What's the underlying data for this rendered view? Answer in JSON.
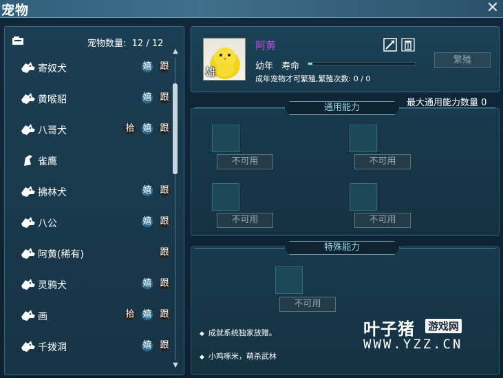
{
  "window": {
    "title": "宠物"
  },
  "left_panel": {
    "count_label": "宠物数量:",
    "count_current": "12",
    "count_sep": "/",
    "count_max": "12",
    "pets": [
      {
        "name": "寄奴犬",
        "badges": [
          "嬉",
          "跟"
        ]
      },
      {
        "name": "黄喉貂",
        "badges": [
          "嬉",
          "跟"
        ]
      },
      {
        "name": "八哥犬",
        "badges": [
          "拾",
          "嬉",
          "跟"
        ]
      },
      {
        "name": "雀鹰",
        "badges": []
      },
      {
        "name": "拂林犬",
        "badges": [
          "嬉",
          "跟"
        ]
      },
      {
        "name": "八公",
        "badges": [
          "嬉",
          "跟"
        ]
      },
      {
        "name": "阿黄(稀有)",
        "badges": [
          "跟"
        ]
      },
      {
        "name": "灵鸦犬",
        "badges": [
          "嬉",
          "跟"
        ]
      },
      {
        "name": "画",
        "badges": [
          "拾",
          "嬉",
          "跟"
        ]
      },
      {
        "name": "千拨洞",
        "badges": [
          "嬉",
          "跟"
        ]
      }
    ]
  },
  "pet_detail": {
    "name": "阿黄",
    "gender": "雄",
    "age": "幼年",
    "life_label": "寿命",
    "life_fraction": 0.04,
    "breed_info": "成年宠物才可繁殖,繁殖次数:  0 / 0",
    "breed_button": "繁殖",
    "name_color": "#c04ee0"
  },
  "common_abilities": {
    "max_label": "最大通用能力数量 0",
    "header": "通用能力",
    "slots": [
      "不可用",
      "不可用",
      "不可用",
      "不可用"
    ]
  },
  "special_abilities": {
    "header": "特殊能力",
    "slots": [
      "不可用"
    ],
    "descriptions": [
      "成就系统独家放赠。",
      "小鸡啄米，萌杀武林"
    ]
  },
  "watermark": {
    "main": "叶子猪",
    "tag": "游戏网",
    "url": "WWW.YZZ.CN"
  }
}
